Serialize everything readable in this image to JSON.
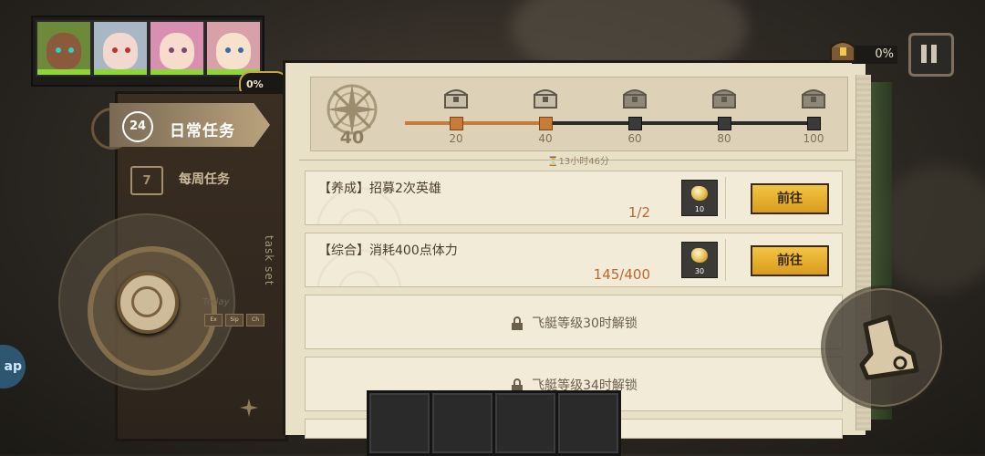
{
  "party": {
    "percent": "0%"
  },
  "sidebar": {
    "daily_tab": {
      "icon_text": "24",
      "label": "日常任务"
    },
    "weekly_tab": {
      "icon_text": "7",
      "label": "每周任务"
    }
  },
  "joystick": {
    "today_label": "Today",
    "buttons": [
      "Ex",
      "Sip",
      "Ch"
    ]
  },
  "panel": {
    "side_label": "task set",
    "progress": {
      "current": "40",
      "value": 40,
      "max": 100,
      "milestones": [
        "20",
        "40",
        "60",
        "80",
        "100"
      ],
      "timer": "13小时46分"
    },
    "tasks": [
      {
        "title": "【养成】招募2次英雄",
        "progress": "1/2",
        "reward_qty": "10",
        "button": "前往"
      },
      {
        "title": "【综合】消耗400点体力",
        "progress": "145/400",
        "reward_qty": "30",
        "button": "前往"
      }
    ],
    "locked": [
      {
        "label": "飞艇等级30时解锁"
      },
      {
        "label": "飞艇等级34时解锁"
      }
    ]
  },
  "hud": {
    "top_percent": "0%",
    "left_pill": "ap"
  },
  "colors": {
    "accent_orange": "#c87c3a",
    "button_gold": "#f3c542",
    "paper": "#e9e0c8"
  }
}
